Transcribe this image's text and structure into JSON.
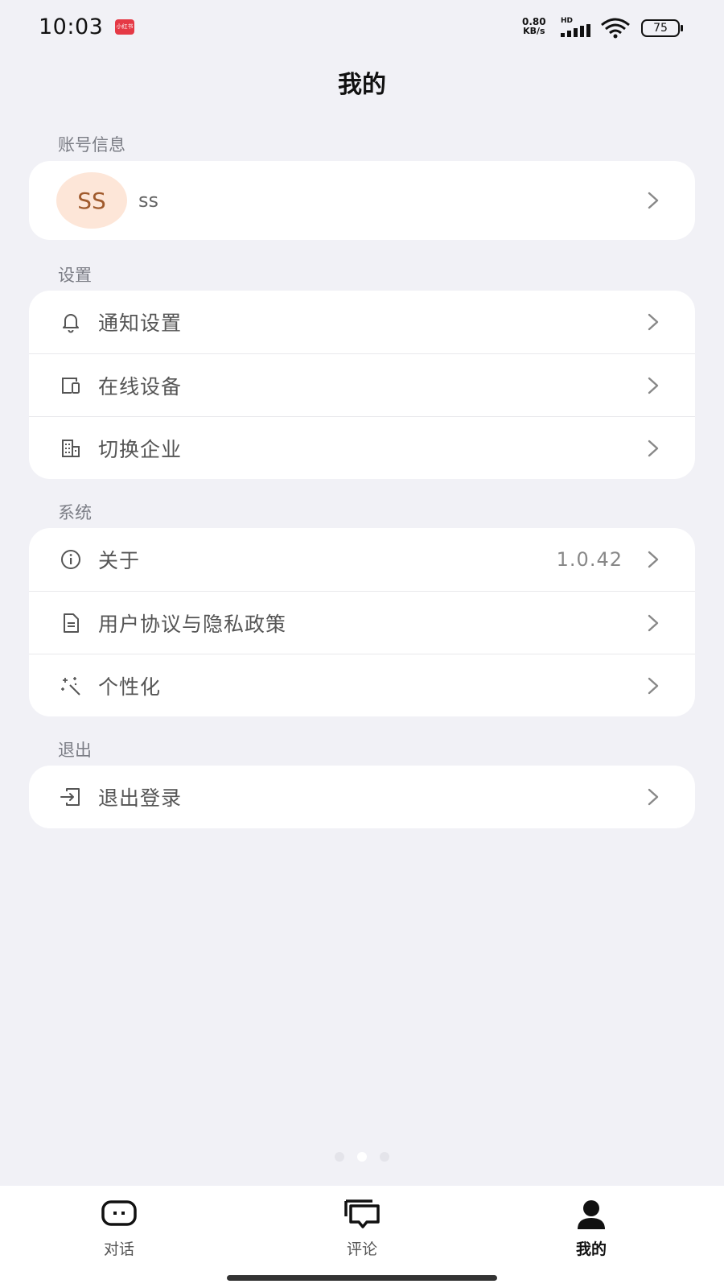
{
  "status_bar": {
    "time": "10:03",
    "app_badge": "小红书",
    "net_speed_value": "0.80",
    "net_speed_unit": "KB/s",
    "network_type": "HD",
    "battery": "75"
  },
  "header": {
    "title": "我的"
  },
  "account": {
    "section_label": "账号信息",
    "avatar_initials": "SS",
    "username": "ss"
  },
  "settings": {
    "section_label": "设置",
    "items": [
      {
        "label": "通知设置",
        "icon": "bell-icon"
      },
      {
        "label": "在线设备",
        "icon": "devices-icon"
      },
      {
        "label": "切换企业",
        "icon": "building-icon"
      }
    ]
  },
  "system": {
    "section_label": "系统",
    "items": [
      {
        "label": "关于",
        "icon": "info-icon",
        "value": "1.0.42"
      },
      {
        "label": "用户协议与隐私政策",
        "icon": "document-icon"
      },
      {
        "label": "个性化",
        "icon": "sparkles-icon"
      }
    ]
  },
  "logout": {
    "section_label": "退出",
    "items": [
      {
        "label": "退出登录",
        "icon": "logout-icon"
      }
    ]
  },
  "bottom_nav": {
    "items": [
      {
        "label": "对话",
        "icon": "chat-icon"
      },
      {
        "label": "评论",
        "icon": "comments-icon"
      },
      {
        "label": "我的",
        "icon": "person-icon",
        "active": true
      }
    ]
  },
  "colors": {
    "background": "#f1f1f6",
    "card": "#ffffff",
    "avatar_bg": "#fde6d8",
    "avatar_text": "#a05a2c",
    "badge": "#e53945"
  }
}
